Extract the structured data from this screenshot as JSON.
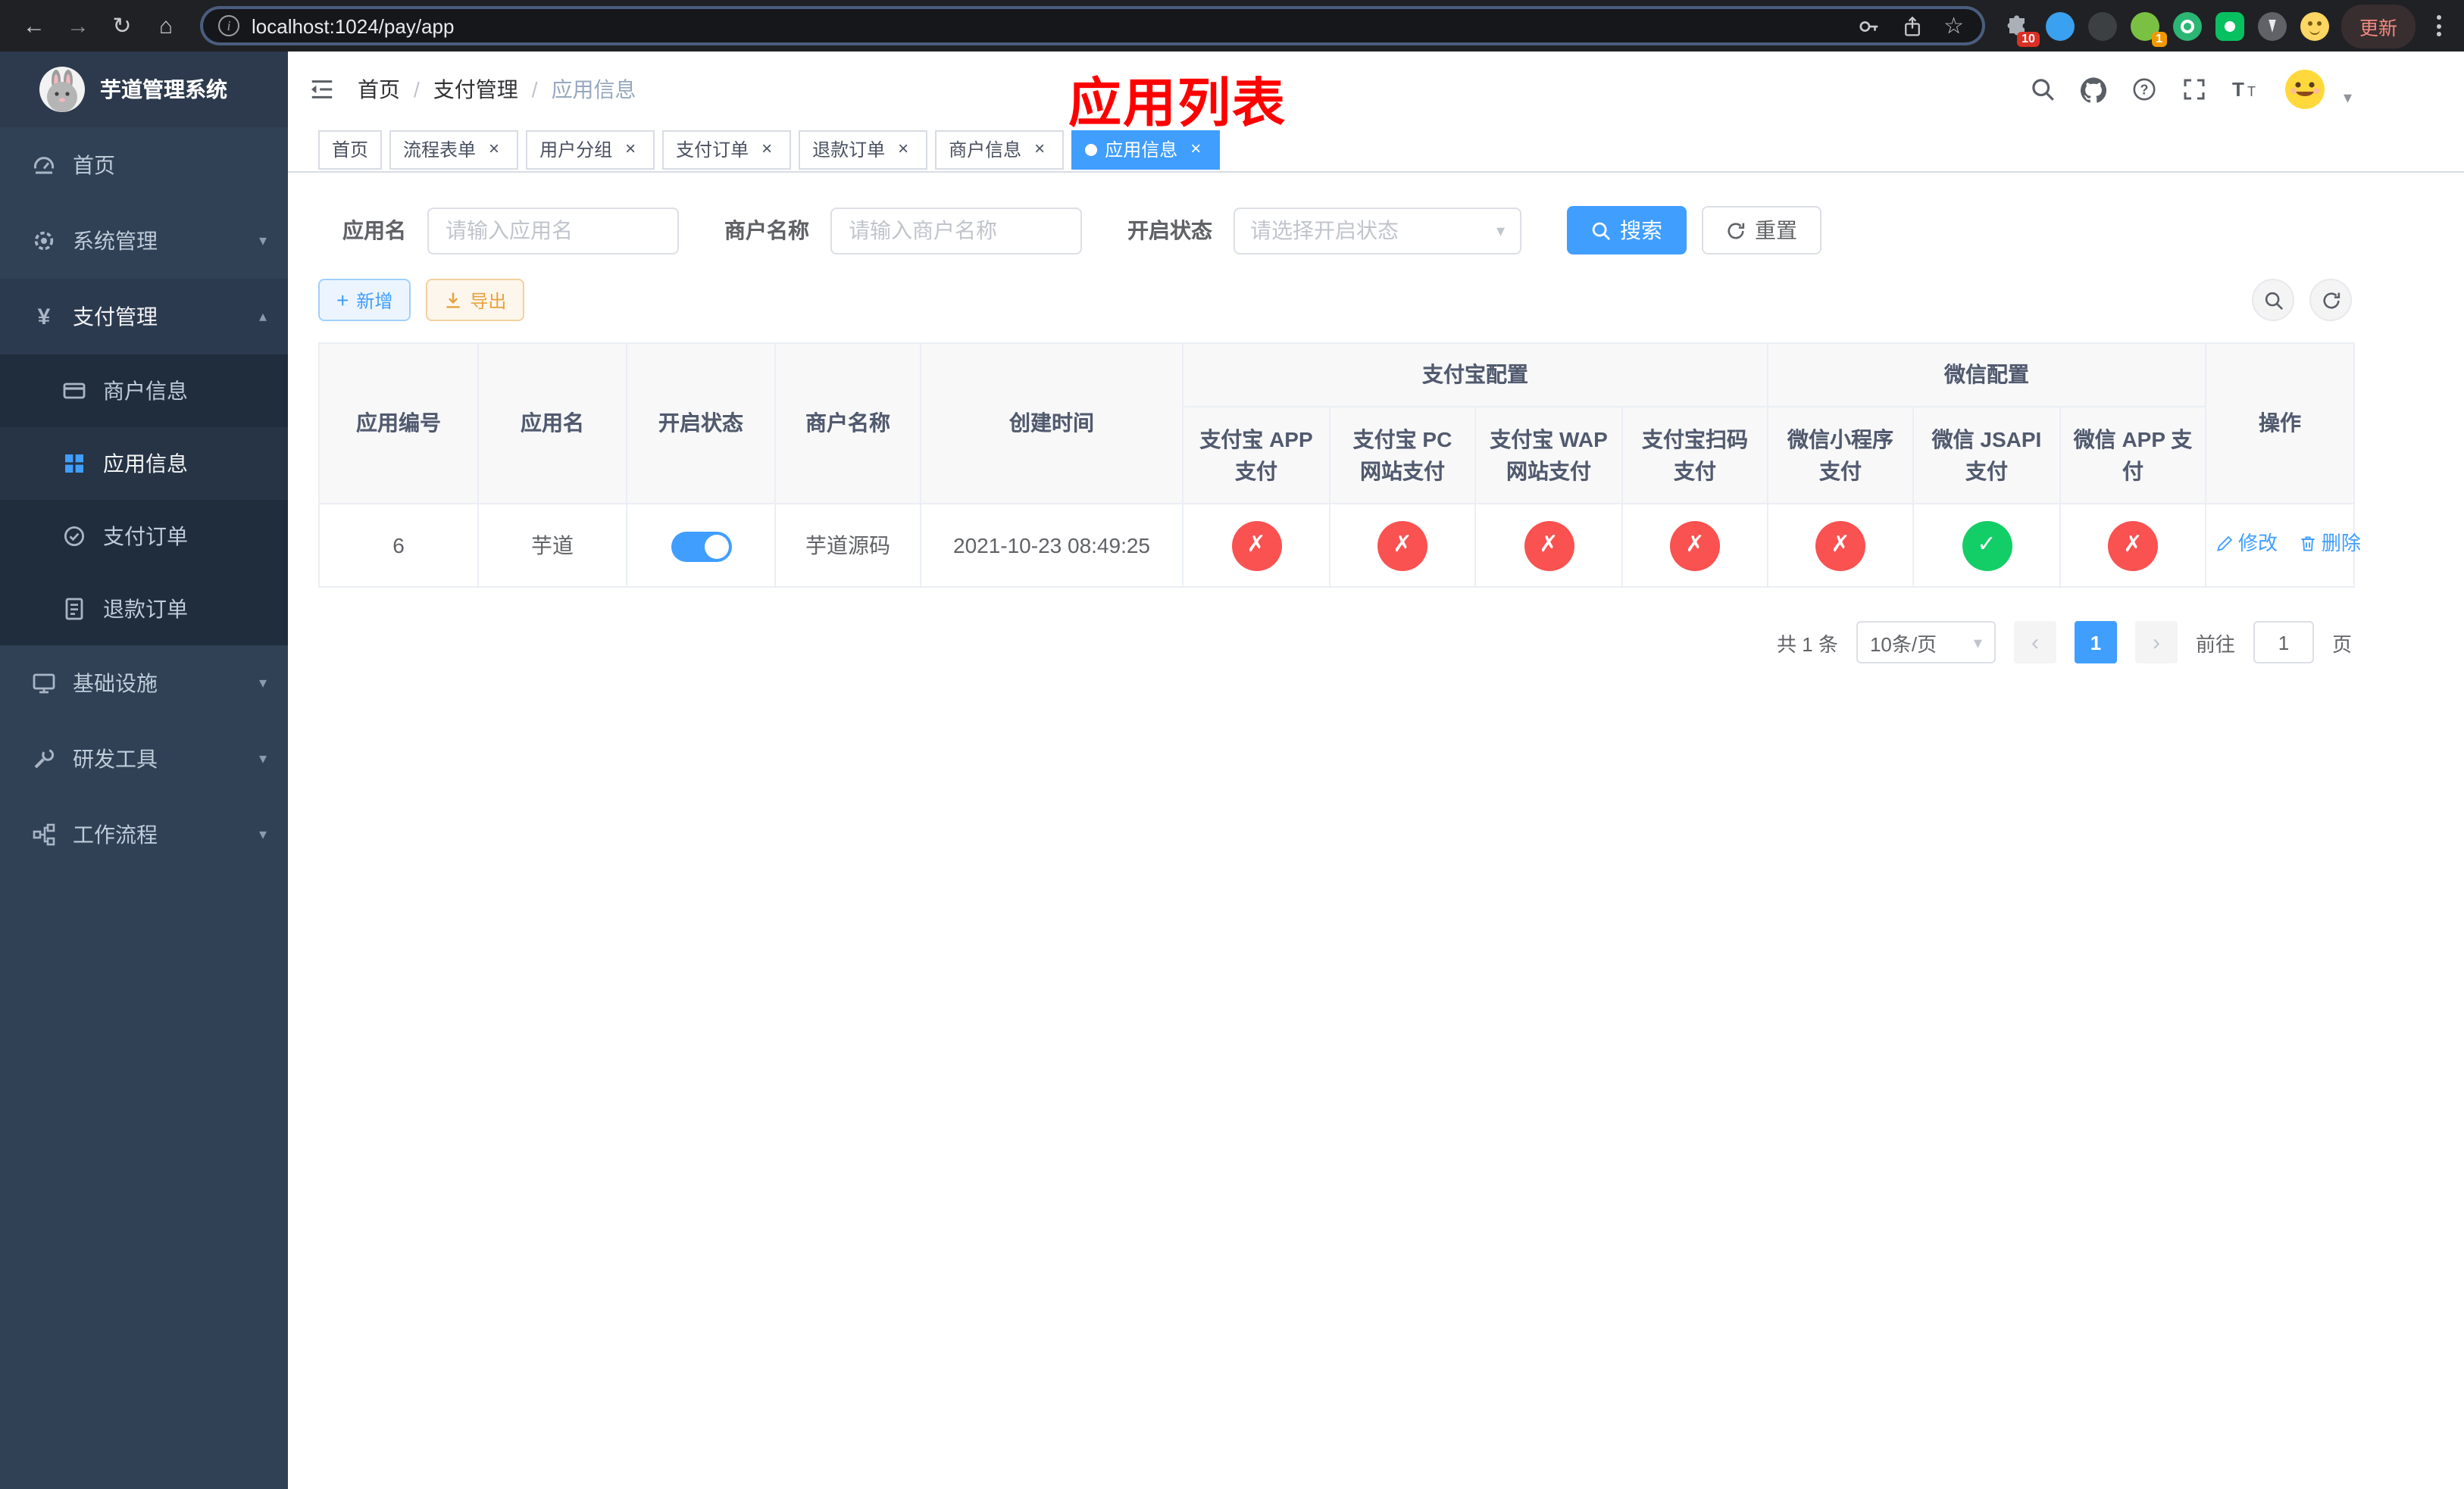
{
  "colors": {
    "primary": "#409eff",
    "success": "#13ce66",
    "danger": "#fa5151",
    "warning": "#e6a23c",
    "annotation_red": "#ff0000",
    "sidebar_bg": "#304156"
  },
  "icons": {
    "back": "←",
    "forward": "→",
    "reload": "↻",
    "home": "⌂",
    "bookmark": "☆",
    "tab_close": "×",
    "caret_down": "▾",
    "caret_up": "▴",
    "plus": "+",
    "prev": "‹",
    "next": "›",
    "breadcrumb_sep": "/"
  },
  "browser": {
    "url": "localhost:1024/pay/app",
    "update_label": "更新",
    "puzzle_badge": "10",
    "avatar_badge": "1"
  },
  "sidebar": {
    "title": "芋道管理系统",
    "menu": [
      {
        "label": "首页"
      },
      {
        "label": "系统管理"
      },
      {
        "label": "支付管理"
      },
      {
        "label": "基础设施"
      },
      {
        "label": "研发工具"
      },
      {
        "label": "工作流程"
      }
    ],
    "submenu": [
      {
        "label": "商户信息"
      },
      {
        "label": "应用信息"
      },
      {
        "label": "支付订单"
      },
      {
        "label": "退款订单"
      }
    ]
  },
  "header": {
    "breadcrumb": [
      "首页",
      "支付管理",
      "应用信息"
    ],
    "annotation": "应用列表"
  },
  "tabs": [
    {
      "label": "首页"
    },
    {
      "label": "流程表单"
    },
    {
      "label": "用户分组"
    },
    {
      "label": "支付订单"
    },
    {
      "label": "退款订单"
    },
    {
      "label": "商户信息"
    },
    {
      "label": "应用信息"
    }
  ],
  "filters": {
    "app_name_label": "应用名",
    "app_name_placeholder": "请输入应用名",
    "merchant_label": "商户名称",
    "merchant_placeholder": "请输入商户名称",
    "status_label": "开启状态",
    "status_placeholder": "请选择开启状态",
    "search_label": "搜索",
    "reset_label": "重置"
  },
  "toolbar": {
    "add_label": "新增",
    "export_label": "导出"
  },
  "table": {
    "groups": {
      "alipay": "支付宝配置",
      "wechat": "微信配置"
    },
    "columns": {
      "id": "应用编号",
      "name": "应用名",
      "status": "开启状态",
      "merchant": "商户名称",
      "created": "创建时间",
      "actions": "操作",
      "alipay": [
        "支付宝 APP 支付",
        "支付宝 PC 网站支付",
        "支付宝 WAP 网站支付",
        "支付宝扫码支付"
      ],
      "wechat": [
        "微信小程序支付",
        "微信 JSAPI 支付",
        "微信 APP 支付"
      ]
    },
    "actions": {
      "edit": "修改",
      "delete": "删除"
    },
    "rows": [
      {
        "id": "6",
        "name": "芋道",
        "status": "on",
        "merchant": "芋道源码",
        "created": "2021-10-23 08:49:25",
        "channels": [
          "fail",
          "fail",
          "fail",
          "fail",
          "fail",
          "success",
          "fail"
        ]
      }
    ]
  },
  "pagination": {
    "total": "共 1 条",
    "page_size": "10条/页",
    "page": "1",
    "goto_label": "前往",
    "goto_value": "1",
    "unit_label": "页"
  }
}
